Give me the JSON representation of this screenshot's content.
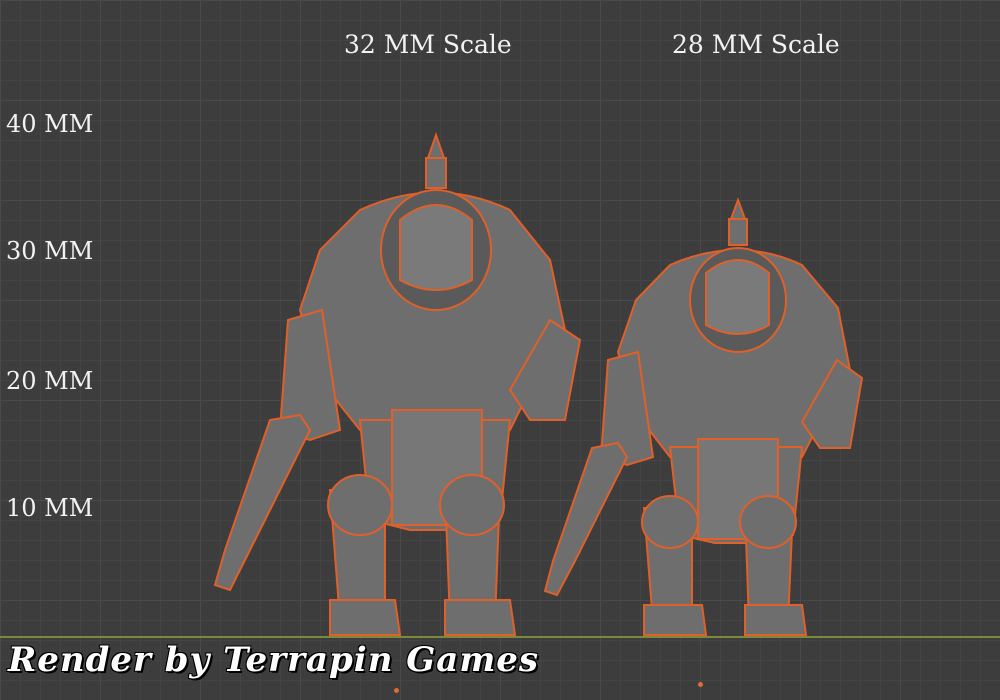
{
  "scale_labels": {
    "left": "32 MM Scale",
    "right": "28 MM Scale"
  },
  "height_markers": [
    "40 MM",
    "30 MM",
    "20 MM",
    "10 MM"
  ],
  "credit": "Render by Terrapin Games",
  "colors": {
    "background": "#3d3d3d",
    "outline": "#e0602a",
    "model": "#6e6e6e",
    "ground_line": "#7a8a3a"
  }
}
